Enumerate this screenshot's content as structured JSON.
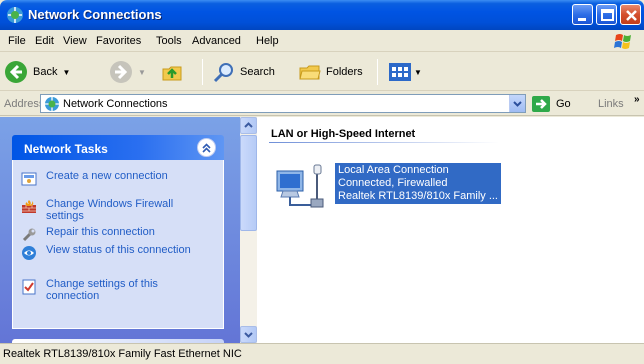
{
  "window": {
    "title": "Network Connections"
  },
  "menu": {
    "file": "File",
    "edit": "Edit",
    "view": "View",
    "favorites": "Favorites",
    "tools": "Tools",
    "advanced": "Advanced",
    "help": "Help"
  },
  "toolbar": {
    "back": "Back",
    "search": "Search",
    "folders": "Folders"
  },
  "address": {
    "label": "Address",
    "value": "Network Connections",
    "go": "Go",
    "links": "Links"
  },
  "tasks": {
    "title": "Network Tasks",
    "items": [
      {
        "label": "Create a new connection",
        "icon": "new-connection-icon"
      },
      {
        "label": "Change Windows Firewall settings",
        "icon": "firewall-icon"
      },
      {
        "label": "Repair this connection",
        "icon": "wrench-icon"
      },
      {
        "label": "View status of this connection",
        "icon": "status-icon"
      },
      {
        "label": "Change settings of this connection",
        "icon": "settings-icon"
      }
    ]
  },
  "content": {
    "group_title": "LAN or High-Speed Internet",
    "connection": {
      "name": "Local Area Connection",
      "status": "Connected, Firewalled",
      "device": "Realtek RTL8139/810x Family ..."
    }
  },
  "status": {
    "text": "Realtek RTL8139/810x Family Fast Ethernet NIC"
  },
  "colors": {
    "titlebar": "#0054e3",
    "selection": "#316ac5",
    "task_link": "#215dc6",
    "pane_bg": "#7ba2e7"
  }
}
